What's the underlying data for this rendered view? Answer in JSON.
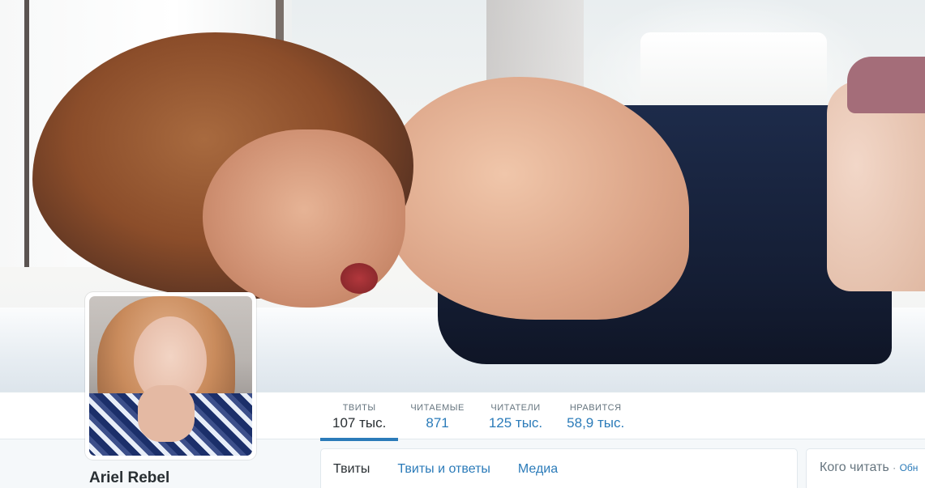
{
  "profile": {
    "name": "Ariel Rebel"
  },
  "stats": [
    {
      "label": "ТВИТЫ",
      "value": "107 тыс."
    },
    {
      "label": "ЧИТАЕМЫЕ",
      "value": "871"
    },
    {
      "label": "ЧИТАТЕЛИ",
      "value": "125 тыс."
    },
    {
      "label": "НРАВИТСЯ",
      "value": "58,9 тыс."
    }
  ],
  "tabs": [
    {
      "label": "Твиты"
    },
    {
      "label": "Твиты и ответы"
    },
    {
      "label": "Медиа"
    }
  ],
  "who_to_follow": {
    "title": "Кого читать",
    "separator": "·",
    "refresh_label": "Обн"
  },
  "colors": {
    "link": "#2b7bb9",
    "text": "#292f33",
    "muted": "#66757f",
    "page_bg": "#f5f8fa"
  }
}
